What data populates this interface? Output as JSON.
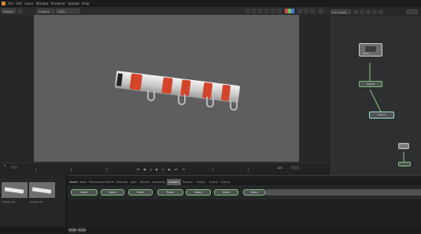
{
  "menubar": {
    "items": [
      "File",
      "Edit",
      "Layer",
      "Window",
      "Renderer",
      "Update",
      "Help"
    ]
  },
  "toolbar": {
    "layer_select": "Default",
    "camera_select": "Camera",
    "zoom": "100%"
  },
  "graph": {
    "header_label": "Full Graph",
    "nodes": [
      {
        "label": "Input"
      },
      {
        "label": "Shader"
      },
      {
        "label": "Output"
      },
      {
        "label": "Group"
      }
    ]
  },
  "timeline": {
    "frame_start": "0",
    "frame_end": "100"
  },
  "media": {
    "thumbs": [
      {
        "label": "Hanger_01"
      },
      {
        "label": "Hanger_02"
      }
    ]
  },
  "shelf": {
    "title": "Nodes",
    "tabs": [
      "Basic",
      "Procedural",
      "Effects",
      "Material",
      "Light",
      "Render",
      "Geometry",
      "Camera",
      "Texture",
      "Utility",
      "Scene",
      "Output"
    ],
    "nodes": [
      "Node",
      "Node",
      "Node",
      "Node",
      "Node",
      "Node",
      "Node",
      "Node"
    ]
  },
  "status": {
    "buttons": [
      "Nodes",
      "Scene"
    ]
  },
  "colors": {
    "accent_orange": "#d88a2c",
    "node_green": "#7fc27a",
    "stripe_red": "#d2452a"
  }
}
